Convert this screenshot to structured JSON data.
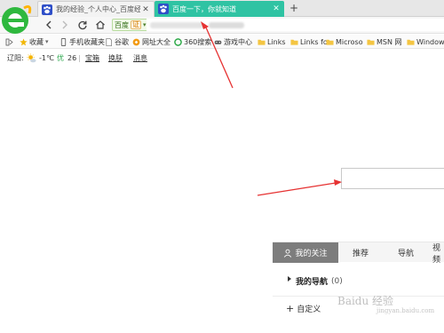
{
  "browser": {
    "tabs": [
      {
        "label": "我的经验_个人中心_百度经验",
        "icon": "baidu-paw-icon",
        "active": false
      },
      {
        "label": "百度一下，你就知道",
        "icon": "baidu-paw-icon",
        "active": true
      }
    ],
    "new_tab": "+",
    "close_glyph": "✕",
    "accent": "#2fc3a3",
    "logo_color": "#2eb83e"
  },
  "navbar": {
    "site_name": "百度",
    "cert_badge": "证",
    "caret": "▾"
  },
  "bookmarks": {
    "items": [
      {
        "label": "收藏",
        "icon": "star-icon",
        "has_caret": true
      },
      {
        "label": "手机收藏夹",
        "icon": "phone-icon"
      },
      {
        "label": "谷歌",
        "icon": "page-icon"
      },
      {
        "label": "网址大全",
        "icon": "web-icon"
      },
      {
        "label": "360搜索",
        "icon": "360-icon"
      },
      {
        "label": "游戏中心",
        "icon": "game-icon"
      },
      {
        "label": "Links",
        "icon": "folder-icon"
      },
      {
        "label": "Links fo",
        "icon": "folder-icon"
      },
      {
        "label": "Microso",
        "icon": "folder-icon"
      },
      {
        "label": "MSN 网",
        "icon": "folder-icon"
      },
      {
        "label": "Window",
        "icon": "folder-icon"
      }
    ]
  },
  "infobar": {
    "city": "辽阳:",
    "temperature": "-1℃",
    "aqi_label": "优",
    "aqi_value": "26",
    "sep": "|",
    "links": [
      "宝箱",
      "换肤",
      "消息"
    ]
  },
  "panel": {
    "tabs": [
      "我的关注",
      "推荐",
      "导航",
      "视频"
    ],
    "nav_title": "我的导航",
    "nav_count": "(0)",
    "custom_label": "自定义"
  },
  "watermark": {
    "main": "Baidu 经验",
    "sub": "jingyan.baidu.com"
  }
}
